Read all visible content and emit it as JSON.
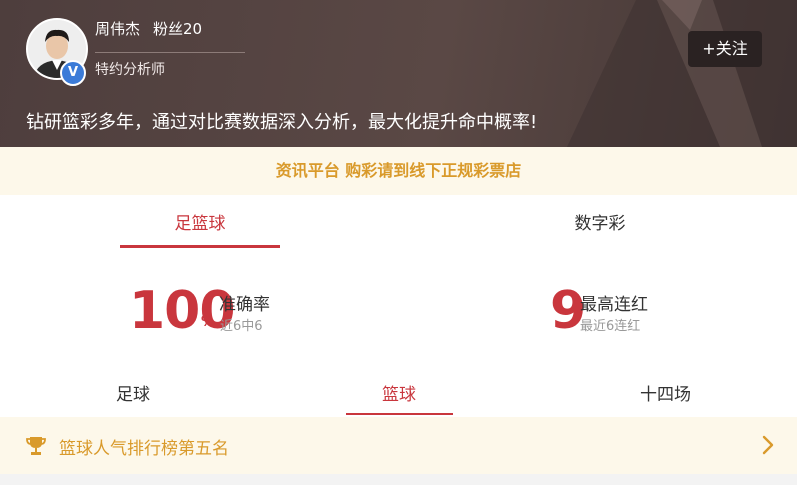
{
  "profile": {
    "name": "周伟杰",
    "fans": "粉丝20",
    "role": "特约分析师",
    "follow_label": "+关注",
    "motto": "钻研篮彩多年，通过对比赛数据深入分析，最大化提升命中概率!",
    "verified_glyph": "V"
  },
  "notice": {
    "text": "资讯平台 购彩请到线下正规彩票店"
  },
  "main_tabs": [
    {
      "label": "足篮球",
      "active": true
    },
    {
      "label": "数字彩",
      "active": false
    }
  ],
  "stats": {
    "accuracy": {
      "value": "100",
      "unit": "%",
      "label": "准确率",
      "sub": "近6中6"
    },
    "streak": {
      "value": "9",
      "label": "最高连红",
      "sub": "最近6连红"
    }
  },
  "sub_tabs": [
    {
      "label": "足球",
      "active": false
    },
    {
      "label": "篮球",
      "active": true
    },
    {
      "label": "十四场",
      "active": false
    }
  ],
  "rank": {
    "text": "篮球人气排行榜第五名",
    "icon": "trophy-icon"
  },
  "colors": {
    "accent": "#c9363d",
    "gold": "#d99a2b",
    "header_bg": "#4e3e3d",
    "notice_bg": "#fdf8ea"
  }
}
